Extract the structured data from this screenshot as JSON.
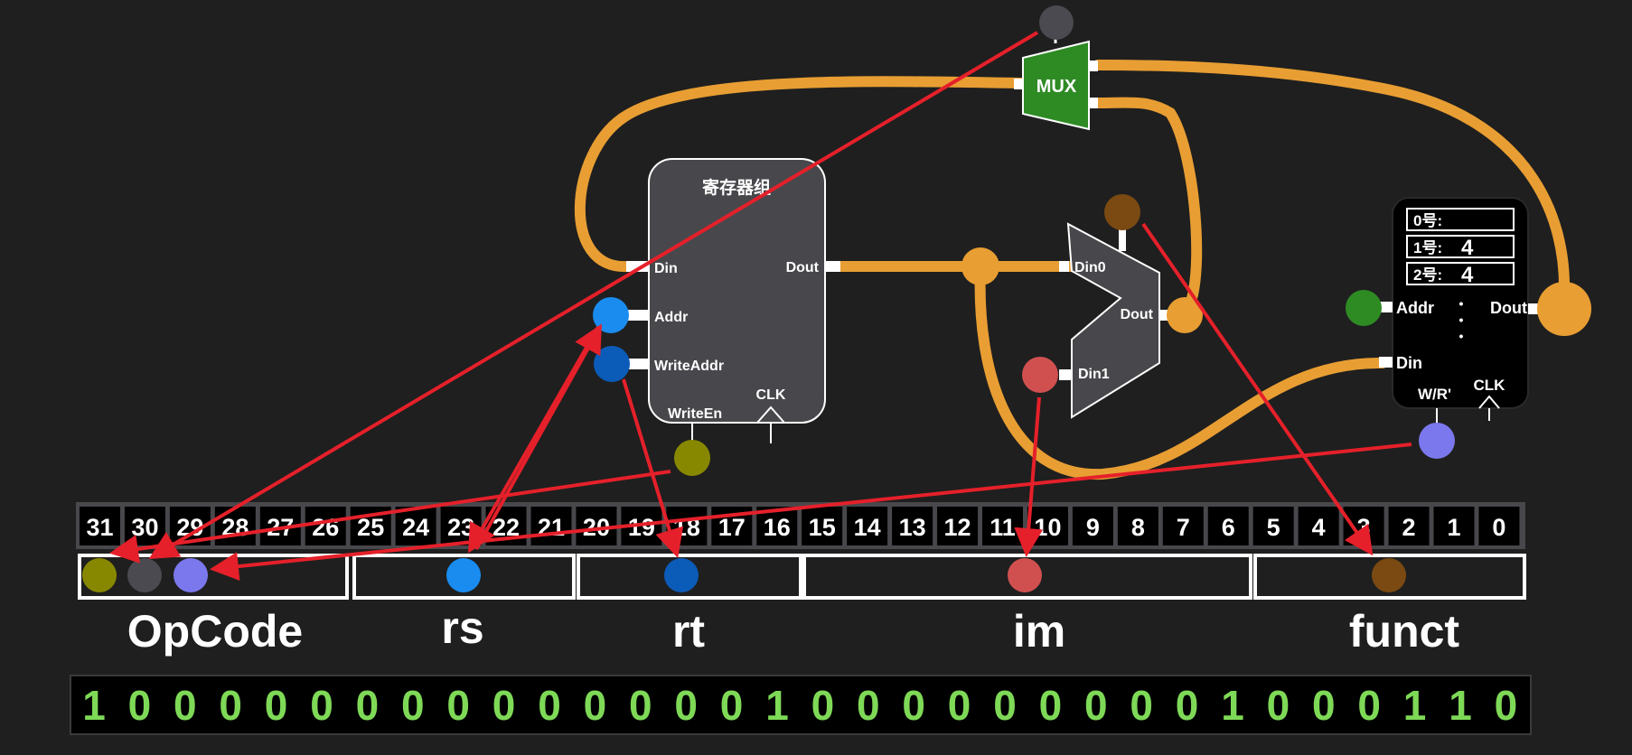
{
  "colors": {
    "background": "#1f1f1f",
    "bus": "#e89e33",
    "arrow": "#e5202a",
    "module_fill": "#48484c",
    "mux_fill": "#2e8b24",
    "binary_text": "#7ed957",
    "dot_olive": "#888800",
    "dot_gray": "#4a4a50",
    "dot_purple": "#7b78ee",
    "dot_blue": "#1a8cf0",
    "dot_darkblue": "#0b5bb8",
    "dot_red": "#d05050",
    "dot_brown": "#7a4a12",
    "dot_green": "#2e8b24"
  },
  "regfile": {
    "title": "寄存器组",
    "din": "Din",
    "dout": "Dout",
    "addr": "Addr",
    "write_addr": "WriteAddr",
    "write_en": "WriteEn",
    "clk": "CLK"
  },
  "mux_top": {
    "label": "MUX"
  },
  "mux_mid": {
    "din0": "Din0",
    "din1": "Din1",
    "dout": "Dout"
  },
  "memory": {
    "rows": [
      {
        "label": "0号:",
        "value": ""
      },
      {
        "label": "1号:",
        "value": "4"
      },
      {
        "label": "2号:",
        "value": "4"
      }
    ],
    "addr": "Addr",
    "dout": "Dout",
    "din": "Din",
    "wr": "W/R'",
    "clk": "CLK",
    "ellipsis": "•"
  },
  "bit_numbers": [
    "31",
    "30",
    "29",
    "28",
    "27",
    "26",
    "25",
    "24",
    "23",
    "22",
    "21",
    "20",
    "19",
    "18",
    "17",
    "16",
    "15",
    "14",
    "13",
    "12",
    "11",
    "10",
    "9",
    "8",
    "7",
    "6",
    "5",
    "4",
    "3",
    "2",
    "1",
    "0"
  ],
  "fields": {
    "opcode": "OpCode",
    "rs": "rs",
    "rt": "rt",
    "im": "im",
    "funct": "funct"
  },
  "binary": [
    "1",
    "0",
    "0",
    "0",
    "0",
    "0",
    "0",
    "0",
    "0",
    "0",
    "0",
    "0",
    "0",
    "0",
    "0",
    "1",
    "0",
    "0",
    "0",
    "0",
    "0",
    "0",
    "0",
    "0",
    "0",
    "1",
    "0",
    "0",
    "0",
    "1",
    "1",
    "0"
  ]
}
